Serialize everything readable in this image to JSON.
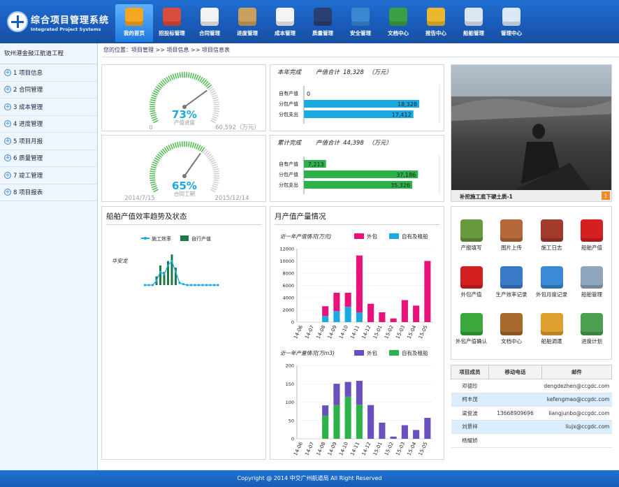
{
  "app": {
    "title": "综合项目管理系统",
    "subtitle": "Integrated Project Systems"
  },
  "nav": [
    {
      "label": "我的首页",
      "icon": "home-icon",
      "color": "#f5a623"
    },
    {
      "label": "招投标管理",
      "icon": "bid-document-icon",
      "color": "#d94c3b"
    },
    {
      "label": "合同管理",
      "icon": "contract-pen-icon",
      "color": "#f2f2f2"
    },
    {
      "label": "进度管理",
      "icon": "books-icon",
      "color": "#c8a060"
    },
    {
      "label": "成本管理",
      "icon": "bar-chart-icon",
      "color": "#f4f4f4"
    },
    {
      "label": "质量管理",
      "icon": "quality-shield-icon",
      "color": "#2b3f73"
    },
    {
      "label": "安全管理",
      "icon": "safety-shield-icon",
      "color": "#3a88d2"
    },
    {
      "label": "文档中心",
      "icon": "document-books-icon",
      "color": "#3aa046"
    },
    {
      "label": "报告中心",
      "icon": "report-stack-icon",
      "color": "#e8b92f"
    },
    {
      "label": "船舶管理",
      "icon": "ship-icon",
      "color": "#dce6f0"
    },
    {
      "label": "管理中心",
      "icon": "monitor-icon",
      "color": "#dbe9f7"
    }
  ],
  "sidebar": {
    "project": "钦州港金鼓江航道工程",
    "items": [
      "1 项目信息",
      "2 合同管理",
      "3 成本管理",
      "4 进度管理",
      "5 项目月报",
      "6 质量管理",
      "7 竣工管理",
      "8 项目报表"
    ]
  },
  "breadcrumb": "您的位置：项目管理 >> 项目信息 >> 项目信息表",
  "gauge_value": {
    "percent": "73%",
    "percent_value": 0.73,
    "label": "产值进度",
    "min": "0",
    "max": "60,592（万元）"
  },
  "gauge_time": {
    "percent": "65%",
    "percent_value": 0.65,
    "label": "合同工期",
    "start": "2014/7/15",
    "end": "2015/12/14"
  },
  "year_summary": {
    "title": "本年完成",
    "total_label": "产值合计",
    "total": "18,328",
    "unit": "（万元）",
    "rows": [
      {
        "label": "自有产值",
        "value": 0,
        "text": "0"
      },
      {
        "label": "分包产值",
        "value": 18328,
        "text": "18,328"
      },
      {
        "label": "分包支出",
        "value": 17412,
        "text": "17,412"
      }
    ],
    "color": "#1aa9e0",
    "max": 20000
  },
  "cum_summary": {
    "title": "累计完成",
    "total_label": "产值合计",
    "total": "44,398",
    "unit": "（万元）",
    "rows": [
      {
        "label": "自有产值",
        "value": 7213,
        "text": "7,213"
      },
      {
        "label": "分包产值",
        "value": 37186,
        "text": "37,186"
      },
      {
        "label": "分包支出",
        "value": 35326,
        "text": "35,326"
      }
    ],
    "color": "#2db14b",
    "max": 41000
  },
  "photo": {
    "caption": "补挖施工底下硬土质-1",
    "badge": "1"
  },
  "ship_panel": {
    "title": "船舶产值效率趋势及状态",
    "legend": [
      "施工效率",
      "自行产值"
    ],
    "ship_name": "华安龙"
  },
  "monthly_panel": {
    "title": "月产值产量情况"
  },
  "chart_data": [
    {
      "type": "bar",
      "title": "近一年产值情况(万元)",
      "stacked": true,
      "categories": [
        "14-06",
        "14-07",
        "14-08",
        "14-09",
        "14-10",
        "14-11",
        "14-12",
        "15-01",
        "15-02",
        "15-03",
        "15-04",
        "15-05"
      ],
      "series": [
        {
          "name": "外包",
          "color": "#e8137a",
          "values": [
            0,
            0,
            1600,
            3000,
            2300,
            9300,
            3000,
            1600,
            600,
            3600,
            2700,
            10000
          ]
        },
        {
          "name": "自有及租船",
          "color": "#1aa9e0",
          "values": [
            0,
            0,
            1000,
            1800,
            2500,
            1600,
            0,
            0,
            0,
            0,
            0,
            0
          ]
        }
      ],
      "ylim": [
        0,
        12000
      ],
      "yticks": [
        0,
        2000,
        4000,
        6000,
        8000,
        10000,
        12000
      ]
    },
    {
      "type": "bar",
      "title": "近一年产量情况(万m3)",
      "stacked": true,
      "categories": [
        "14-06",
        "14-07",
        "14-08",
        "14-09",
        "14-10",
        "14-11",
        "14-12",
        "15-01",
        "15-02",
        "15-03",
        "15-04",
        "15-05"
      ],
      "series": [
        {
          "name": "外包",
          "color": "#6a4fc1",
          "values": [
            0,
            0,
            28,
            58,
            40,
            65,
            92,
            44,
            6,
            37,
            24,
            57
          ]
        },
        {
          "name": "自有及租船",
          "color": "#2db14b",
          "values": [
            0,
            0,
            63,
            92,
            115,
            93,
            0,
            0,
            0,
            0,
            0,
            0
          ]
        }
      ],
      "ylim": [
        0,
        200
      ],
      "yticks": [
        0,
        50,
        100,
        150,
        200
      ]
    },
    {
      "type": "bar",
      "title": "",
      "legend": [
        "施工效率",
        "自行产值"
      ],
      "categories": [
        "1",
        "2",
        "3",
        "4",
        "5",
        "6",
        "7",
        "8",
        "9",
        "10",
        "11",
        "12",
        "13",
        "14",
        "15",
        "16",
        "17",
        "18",
        "19",
        "20"
      ],
      "series": [
        {
          "name": "自行产值",
          "type": "bar",
          "color": "#1d7a45",
          "values": [
            0,
            0,
            0,
            20,
            45,
            30,
            55,
            70,
            40,
            0,
            0,
            0,
            0,
            0,
            0,
            0,
            0,
            0,
            0,
            0
          ]
        },
        {
          "name": "施工效率",
          "type": "line",
          "color": "#1aa9e0",
          "values": [
            0,
            0,
            0,
            10,
            30,
            25,
            45,
            55,
            30,
            5,
            2,
            0,
            0,
            0,
            0,
            0,
            0,
            0,
            0,
            0
          ]
        }
      ],
      "ylim": [
        0,
        80
      ]
    }
  ],
  "tools": [
    {
      "label": "产报填写",
      "icon": "report-fill-icon",
      "color": "#6a9a3e"
    },
    {
      "label": "图片上传",
      "icon": "picture-upload-icon",
      "color": "#b5683a"
    },
    {
      "label": "施工日志",
      "icon": "construction-log-icon",
      "color": "#a33b2c"
    },
    {
      "label": "船舶产值",
      "icon": "yen-icon",
      "color": "#d42020"
    },
    {
      "label": "外包产值",
      "icon": "yen-icon",
      "color": "#d42020"
    },
    {
      "label": "生产效率记录",
      "icon": "efficiency-chart-icon",
      "color": "#3a7bc8"
    },
    {
      "label": "外包月度记录",
      "icon": "percent-dial-icon",
      "color": "#3a8ad6"
    },
    {
      "label": "船舶管理",
      "icon": "ship-icon",
      "color": "#8fa6bf"
    },
    {
      "label": "外包产值确认",
      "icon": "checkmark-icon",
      "color": "#3aa83a"
    },
    {
      "label": "文档中心",
      "icon": "document-books-icon",
      "color": "#a86a2c"
    },
    {
      "label": "船舶调遣",
      "icon": "dispatch-icon",
      "color": "#e0a030"
    },
    {
      "label": "进度计划",
      "icon": "schedule-plan-icon",
      "color": "#4aa050"
    }
  ],
  "members": {
    "headers": [
      "项目成员",
      "移动电话",
      "邮件"
    ],
    "rows": [
      {
        "name": "邓德珍",
        "phone": "",
        "email": "dengdezhen@ccgdc.com"
      },
      {
        "name": "柯丰茂",
        "phone": "",
        "email": "kefengmao@ccgdc.com"
      },
      {
        "name": "梁俊波",
        "phone": "13668909696",
        "email": "liangjunbo@ccgdc.com"
      },
      {
        "name": "刘景祥",
        "phone": "",
        "email": "liujx@ccgdc.com"
      },
      {
        "name": "杨耀娇",
        "phone": "",
        "email": ""
      }
    ]
  },
  "footer": "Copyright @ 2014 中交广州航道局 All Right Reserved"
}
